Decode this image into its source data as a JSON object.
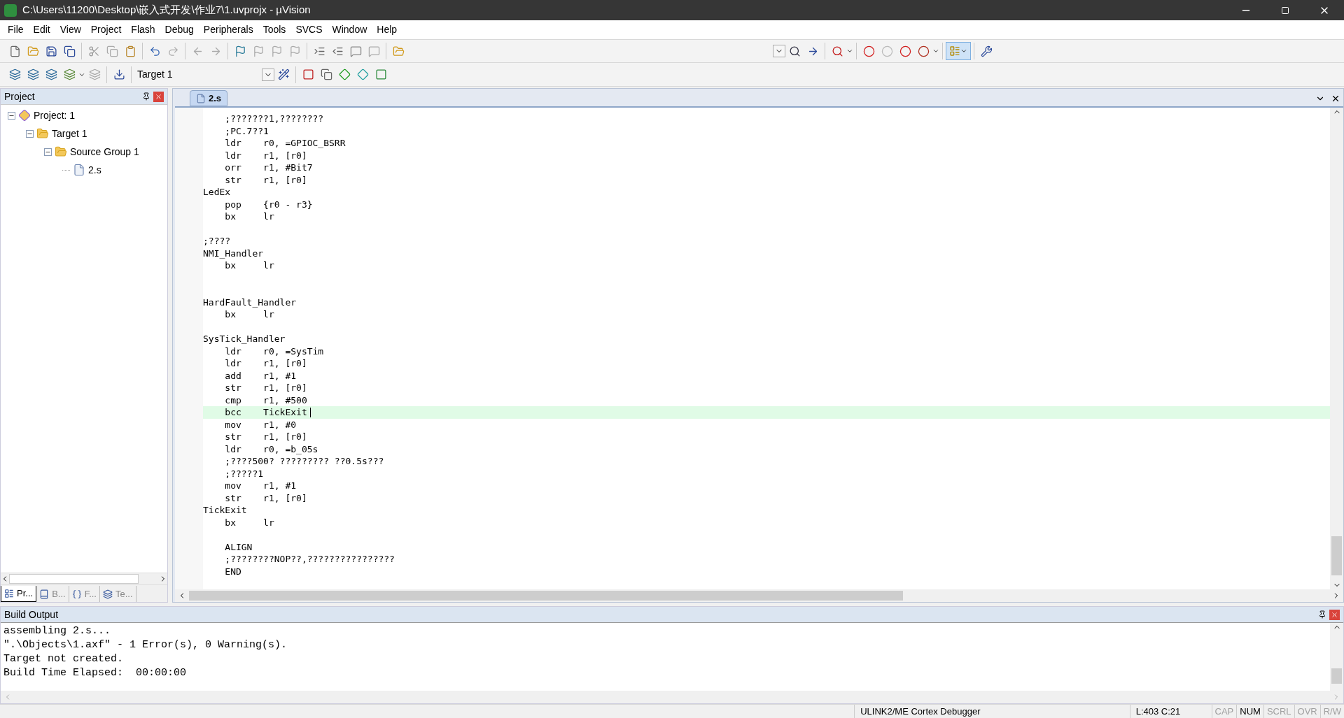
{
  "window": {
    "title": "C:\\Users\\11200\\Desktop\\嵌入式开发\\作业7\\1.uvprojx - µVision"
  },
  "menu": [
    "File",
    "Edit",
    "View",
    "Project",
    "Flash",
    "Debug",
    "Peripherals",
    "Tools",
    "SVCS",
    "Window",
    "Help"
  ],
  "toolbar2": {
    "target": "Target 1"
  },
  "project_panel": {
    "title": "Project",
    "tree": [
      {
        "label": "Project: 1",
        "kind": "project",
        "expanded": true,
        "children": [
          {
            "label": "Target 1",
            "kind": "target",
            "expanded": true,
            "children": [
              {
                "label": "Source Group 1",
                "kind": "group",
                "expanded": true,
                "children": [
                  {
                    "label": "2.s",
                    "kind": "file"
                  }
                ]
              }
            ]
          }
        ]
      }
    ],
    "tabs": [
      {
        "label": "Pr...",
        "kind": "project",
        "selected": true
      },
      {
        "label": "B...",
        "kind": "books",
        "selected": false
      },
      {
        "label": "F...",
        "kind": "functions",
        "selected": false
      },
      {
        "label": "Te...",
        "kind": "templates",
        "selected": false
      }
    ]
  },
  "editor": {
    "tabs": [
      {
        "label": "2.s",
        "selected": true
      }
    ],
    "lines": [
      {
        "text": "    ;???????1,????????",
        "current": false
      },
      {
        "text": "    ;PC.7??1",
        "current": false
      },
      {
        "text": "    ldr    r0, =GPIOC_BSRR",
        "current": false
      },
      {
        "text": "    ldr    r1, [r0]",
        "current": false
      },
      {
        "text": "    orr    r1, #Bit7",
        "current": false
      },
      {
        "text": "    str    r1, [r0]",
        "current": false
      },
      {
        "text": "LedEx",
        "current": false
      },
      {
        "text": "    pop    {r0 - r3}",
        "current": false
      },
      {
        "text": "    bx     lr",
        "current": false
      },
      {
        "current": false
      },
      {
        "text": ";????",
        "current": false
      },
      {
        "text": "NMI_Handler",
        "current": false
      },
      {
        "text": "    bx     lr",
        "current": false
      },
      {
        "current": false
      },
      {
        "current": false
      },
      {
        "text": "HardFault_Handler",
        "current": false
      },
      {
        "text": "    bx     lr",
        "current": false
      },
      {
        "current": false
      },
      {
        "text": "SysTick_Handler",
        "current": false
      },
      {
        "text": "    ldr    r0, =SysTim",
        "current": false
      },
      {
        "text": "    ldr    r1, [r0]",
        "current": false
      },
      {
        "text": "    add    r1, #1",
        "current": false
      },
      {
        "text": "    str    r1, [r0]",
        "current": false
      },
      {
        "text": "    cmp    r1, #500",
        "current": false
      },
      {
        "text": "    bcc    TickExit",
        "current": true
      },
      {
        "text": "    mov    r1, #0",
        "current": false
      },
      {
        "text": "    str    r1, [r0]",
        "current": false
      },
      {
        "text": "    ldr    r0, =b_05s",
        "current": false
      },
      {
        "text": "    ;????500? ????????? ??0.5s???",
        "current": false
      },
      {
        "text": "    ;?????1",
        "current": false
      },
      {
        "text": "    mov    r1, #1",
        "current": false
      },
      {
        "text": "    str    r1, [r0]",
        "current": false
      },
      {
        "text": "TickExit",
        "current": false
      },
      {
        "text": "    bx     lr",
        "current": false
      },
      {
        "current": false
      },
      {
        "text": "    ALIGN",
        "current": false
      },
      {
        "text": "    ;????????NOP??,????????????????",
        "current": false
      },
      {
        "text": "    END",
        "current": false
      }
    ]
  },
  "build_output": {
    "title": "Build Output",
    "lines": [
      "assembling 2.s...",
      "\".\\Objects\\1.axf\" - 1 Error(s), 0 Warning(s).",
      "Target not created.",
      "Build Time Elapsed:  00:00:00"
    ]
  },
  "status_bar": {
    "debugger": "ULINK2/ME Cortex Debugger",
    "position": "L:403 C:21",
    "indicators": [
      {
        "label": "CAP",
        "on": false
      },
      {
        "label": "NUM",
        "on": true
      },
      {
        "label": "SCRL",
        "on": false
      },
      {
        "label": "OVR",
        "on": false
      },
      {
        "label": "R/W",
        "on": false
      }
    ]
  }
}
